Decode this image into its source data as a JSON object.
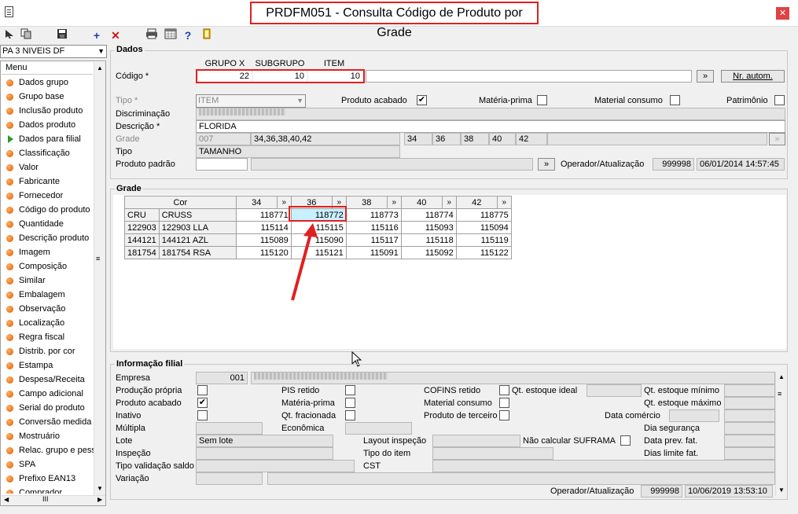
{
  "window": {
    "title": "PRDFM051 - Consulta Código de Produto por Grade",
    "close": "✕"
  },
  "toolbar": {
    "icons": [
      "cursor-icon",
      "copy-icon",
      "save-icon",
      "add-icon",
      "delete-icon",
      "print-icon",
      "calendar-icon",
      "help-icon",
      "exit-icon"
    ],
    "add": "+",
    "delete": "✕",
    "help": "?"
  },
  "combo": {
    "value": "PA 3 NIVEIS DF"
  },
  "menu": {
    "header": "Menu",
    "items": [
      "Dados grupo",
      "Grupo base",
      "Inclusão produto",
      "Dados produto",
      "Dados para filial",
      "Classificação",
      "Valor",
      "Fabricante",
      "Fornecedor",
      "Código do produto",
      "Quantidade",
      "Descrição produto",
      "Imagem",
      "Composição",
      "Similar",
      "Embalagem",
      "Observação",
      "Localização",
      "Regra fiscal",
      "Distrib. por cor",
      "Estampa",
      "Despesa/Receita",
      "Campo adicional",
      "Serial do produto",
      "Conversão medida",
      "Mostruário",
      "Relac. grupo e pess",
      "SPA",
      "Prefixo EAN13",
      "Comprador"
    ]
  },
  "dados": {
    "title": "Dados",
    "headers": {
      "grupo": "GRUPO X",
      "subgrupo": "SUBGRUPO",
      "item": "ITEM"
    },
    "codigo_label": "Código *",
    "codigo": {
      "grupo": "22",
      "subgrupo": "10",
      "item": "10"
    },
    "next_btn": "»",
    "nr_autom": "Nr. autom.",
    "tipo_label": "Tipo *",
    "tipo_value": "ITEM",
    "produto_acabado_label": "Produto acabado",
    "produto_acabado": true,
    "materia_prima_label": "Matéria-prima",
    "material_consumo_label": "Material consumo",
    "patrimonio_label": "Patrimônio",
    "discriminacao_label": "Discriminação",
    "discriminacao_value": "xxxxxxxxxxxxxxxxxx",
    "descricao_label": "Descrição *",
    "descricao_value": "FLORIDA",
    "grade_label": "Grade",
    "grade_code": "007",
    "grade_sizes": "34,36,38,40,42",
    "grade_cols": [
      "34",
      "36",
      "38",
      "40",
      "42"
    ],
    "tipo2_label": "Tipo",
    "tipo2_value": "TAMANHO",
    "produto_padrao_label": "Produto padrão",
    "operador_label": "Operador/Atualização",
    "operador_value": "999998",
    "operador_date": "06/01/2014 14:57:45"
  },
  "grade": {
    "title": "Grade",
    "cor_header": "Cor",
    "sizes": [
      "34",
      "36",
      "38",
      "40",
      "42"
    ],
    "size_btn": "»",
    "rows": [
      {
        "code": "CRU",
        "name": "CRUSS",
        "values": [
          "118771",
          "118772",
          "118773",
          "118774",
          "118775"
        ]
      },
      {
        "code": "122903",
        "name": "122903 LLA",
        "values": [
          "115114",
          "115115",
          "115116",
          "115093",
          "115094"
        ]
      },
      {
        "code": "144121",
        "name": "144121 AZL",
        "values": [
          "115089",
          "115090",
          "115117",
          "115118",
          "115119"
        ]
      },
      {
        "code": "181754",
        "name": "181754 RSA",
        "values": [
          "115120",
          "115121",
          "115091",
          "115092",
          "115122"
        ]
      }
    ]
  },
  "filial": {
    "title": "Informação filial",
    "empresa_label": "Empresa",
    "empresa_code": "001",
    "empresa_name": "xxxxxxxxxxxxxxxxxxxxxxxxxx",
    "producao_propria": "Produção própria",
    "pis_retido": "PIS retido",
    "cofins_retido": "COFINS retido",
    "qt_estoque_ideal": "Qt. estoque ideal",
    "qt_estoque_minimo": "Qt. estoque mínimo",
    "produto_acabado": "Produto acabado",
    "materia_prima": "Matéria-prima",
    "material_consumo": "Material consumo",
    "qt_estoque_maximo": "Qt. estoque máximo",
    "inativo": "Inativo",
    "qt_fracionada": "Qt. fracionada",
    "produto_terceiro": "Produto de terceiro",
    "data_comercio": "Data comércio",
    "multipla": "Múltipla",
    "economica": "Econômica",
    "dia_seguranca": "Dia segurança",
    "lote_label": "Lote",
    "lote_value": "Sem lote",
    "layout_inspecao": "Layout inspeção",
    "nao_calcular_suframa": "Não calcular SUFRAMA",
    "data_prev_fat": "Data prev. fat.",
    "inspecao": "Inspeção",
    "tipo_item": "Tipo do item",
    "dias_limite_fat": "Dias limite fat.",
    "tipo_validacao_saldo": "Tipo validação saldo",
    "cst": "CST",
    "variacao": "Variação",
    "operador_label": "Operador/Atualização",
    "operador_value": "999998",
    "operador_date": "10/06/2019 13:53:10"
  }
}
